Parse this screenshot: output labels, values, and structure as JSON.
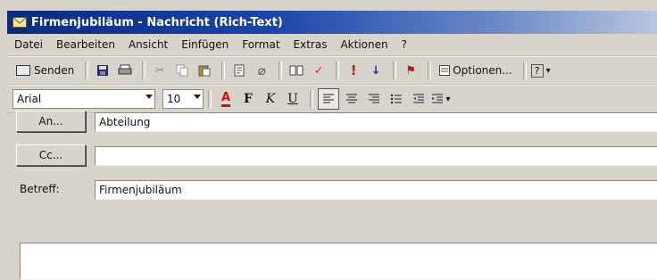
{
  "window": {
    "title": "Firmenjubiläum - Nachricht (Rich-Text)"
  },
  "menu": [
    "Datei",
    "Bearbeiten",
    "Ansicht",
    "Einfügen",
    "Format",
    "Extras",
    "Aktionen",
    "?"
  ],
  "toolbar": {
    "send_label": "Senden",
    "options_label": "Optionen...",
    "help_label": "?"
  },
  "formatting": {
    "font": "Arial",
    "size": "10",
    "bold": "F",
    "italic": "K",
    "underline": "U"
  },
  "header": {
    "to_button": "An...",
    "to_value": "Abteilung",
    "cc_button": "Cc...",
    "cc_value": "",
    "subject_label": "Betreff:",
    "subject_value": "Firmenjubiläum"
  }
}
